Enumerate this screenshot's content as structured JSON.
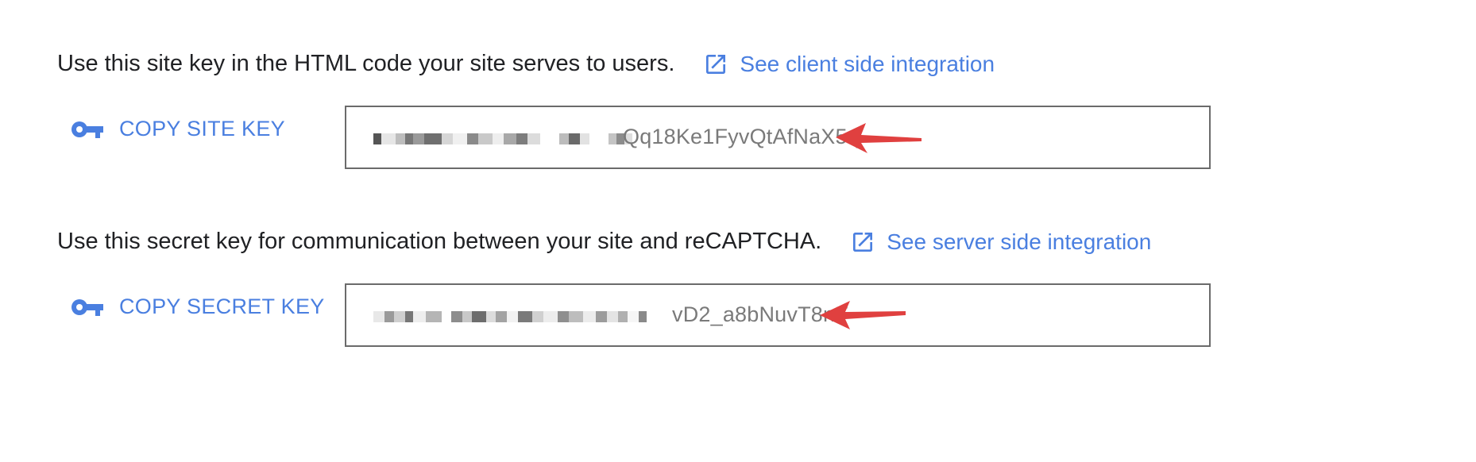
{
  "site_key_section": {
    "description": "Use this site key in the HTML code your site serves to users.",
    "link_label": "See client side integration",
    "link_icon": "open-in-new-icon",
    "copy_label": "COPY SITE KEY",
    "copy_icon": "key-icon",
    "key_visible_tail": "Qq18Ke1FyvQtAfNaX5q"
  },
  "secret_key_section": {
    "description": "Use this secret key for communication between your site and reCAPTCHA.",
    "link_label": "See server side integration",
    "link_icon": "open-in-new-icon",
    "copy_label": "COPY SECRET KEY",
    "copy_icon": "key-icon",
    "key_visible_tail": "vD2_a8bNuvT8nF"
  },
  "colors": {
    "link": "#4a7fe0",
    "text": "#202124",
    "key_text": "#7a7a7a",
    "box_border": "#6b6b6b",
    "annotation_arrow": "#e0403f"
  }
}
